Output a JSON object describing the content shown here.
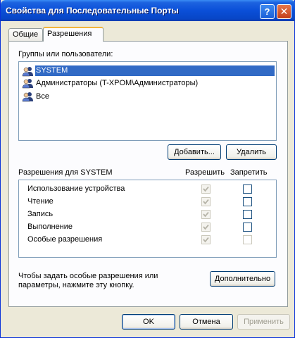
{
  "window": {
    "title": "Свойства для Последовательные Порты",
    "help_glyph": "?",
    "close_glyph": "✕"
  },
  "tabs": [
    {
      "label": "Общие",
      "active": false
    },
    {
      "label": "Разрешения",
      "active": true
    }
  ],
  "groups": {
    "label": "Группы или пользователи:",
    "items": [
      {
        "label": "SYSTEM",
        "selected": true,
        "icon": "users-group-icon"
      },
      {
        "label": "Администраторы (T-XPOM\\Администраторы)",
        "selected": false,
        "icon": "users-group-icon"
      },
      {
        "label": "Все",
        "selected": false,
        "icon": "users-group-icon"
      }
    ]
  },
  "add_button": "Добавить...",
  "remove_button": "Удалить",
  "permissions": {
    "label": "Разрешения для SYSTEM",
    "allow_header": "Разрешить",
    "deny_header": "Запретить",
    "rows": [
      {
        "name": "Использование устройства",
        "allow": true,
        "deny": false,
        "deny_enabled": true
      },
      {
        "name": "Чтение",
        "allow": true,
        "deny": false,
        "deny_enabled": true
      },
      {
        "name": "Запись",
        "allow": true,
        "deny": false,
        "deny_enabled": true
      },
      {
        "name": "Выполнение",
        "allow": true,
        "deny": false,
        "deny_enabled": true
      },
      {
        "name": "Особые разрешения",
        "allow": true,
        "deny": false,
        "deny_enabled": false
      }
    ]
  },
  "advanced": {
    "text_line1": "Чтобы задать особые разрешения или",
    "text_line2": "параметры, нажмите эту кнопку.",
    "button": "Дополнительно"
  },
  "footer": {
    "ok": "OK",
    "cancel": "Отмена",
    "apply": "Применить"
  }
}
